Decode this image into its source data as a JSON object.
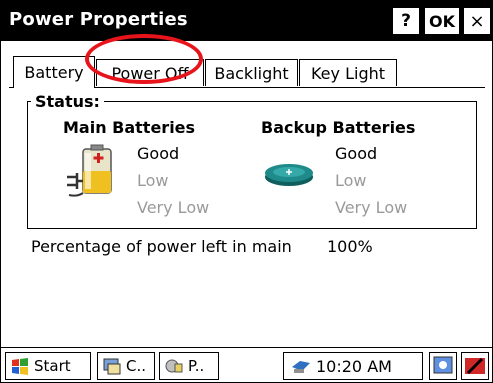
{
  "window": {
    "title": "Power Properties",
    "help_label": "?",
    "ok_label": "OK",
    "close_label": "×"
  },
  "tabs": [
    {
      "label": "Battery",
      "active": true
    },
    {
      "label": "Power Off",
      "active": false
    },
    {
      "label": "Backlight",
      "active": false
    },
    {
      "label": "Key Light",
      "active": false
    }
  ],
  "status": {
    "label": "Status:",
    "main": {
      "heading": "Main Batteries",
      "icon": "battery-icon",
      "levels": [
        "Good",
        "Low",
        "Very Low"
      ],
      "current": "Good"
    },
    "backup": {
      "heading": "Backup Batteries",
      "icon": "coin-cell-icon",
      "levels": [
        "Good",
        "Low",
        "Very Low"
      ],
      "current": "Good"
    }
  },
  "percentage": {
    "label": "Percentage of power left in main",
    "value": "100%"
  },
  "taskbar": {
    "start_label": "Start",
    "tasks": [
      {
        "label": "C..",
        "icon": "control-panel-icon"
      },
      {
        "label": "P..",
        "icon": "power-icon"
      }
    ],
    "clock": "10:20 AM",
    "tray_icons": [
      "network-icon",
      "desktop-icon",
      "input-panel-icon"
    ]
  },
  "colors": {
    "titlebar_bg": "#000000",
    "highlight_ellipse": "#e8141c",
    "inactive_text": "#9a9a9a"
  }
}
